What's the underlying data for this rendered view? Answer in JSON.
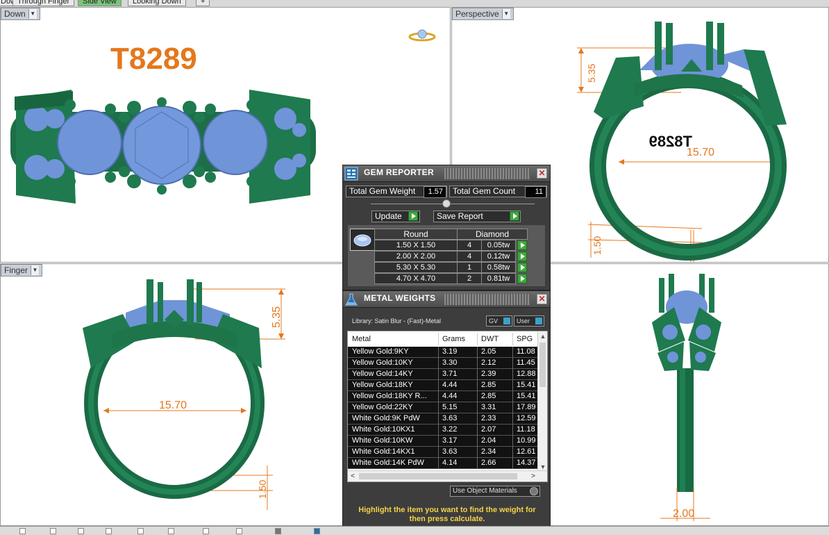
{
  "top_tabs": [
    "Down",
    "Through Finger",
    "Side View",
    "Looking Down",
    "+"
  ],
  "viewports": {
    "top_left": {
      "label": "Down",
      "model_code": "T8289"
    },
    "top_right": {
      "label": "Perspective",
      "dim_height": "5.35",
      "dim_diameter": "15.70",
      "dim_band": "1.50",
      "engraving": "T8289"
    },
    "bottom_left": {
      "label": "Finger",
      "dim_height": "5.35",
      "dim_diameter": "15.70",
      "dim_band": "1.50"
    },
    "bottom_right": {
      "dim_width": "2.00"
    }
  },
  "gem_reporter": {
    "title": "GEM REPORTER",
    "total_weight_label": "Total Gem Weight",
    "total_weight_value": "1.57",
    "total_count_label": "Total Gem Count",
    "total_count_value": "11",
    "update_label": "Update",
    "save_label": "Save Report",
    "shape": "Round",
    "material": "Diamond",
    "rows": [
      {
        "size": "1.50 X 1.50",
        "count": "4",
        "weight": "0.05tw"
      },
      {
        "size": "2.00 X 2.00",
        "count": "4",
        "weight": "0.12tw"
      },
      {
        "size": "5.30 X 5.30",
        "count": "1",
        "weight": "0.58tw"
      },
      {
        "size": "4.70 X 4.70",
        "count": "2",
        "weight": "0.81tw"
      }
    ]
  },
  "metal_weights": {
    "title": "METAL WEIGHTS",
    "library": "Library: Satin Blur - (Fast)-Metal",
    "gv_label": "GV",
    "user_label": "User",
    "columns": [
      "Metal",
      "Grams",
      "DWT",
      "SPG"
    ],
    "rows": [
      {
        "metal": "Yellow Gold:9KY",
        "grams": "3.19",
        "dwt": "2.05",
        "spg": "11.08"
      },
      {
        "metal": "Yellow Gold:10KY",
        "grams": "3.30",
        "dwt": "2.12",
        "spg": "11.45"
      },
      {
        "metal": "Yellow Gold:14KY",
        "grams": "3.71",
        "dwt": "2.39",
        "spg": "12.88"
      },
      {
        "metal": "Yellow Gold:18KY",
        "grams": "4.44",
        "dwt": "2.85",
        "spg": "15.41"
      },
      {
        "metal": "Yellow Gold:18KY R...",
        "grams": "4.44",
        "dwt": "2.85",
        "spg": "15.41"
      },
      {
        "metal": "Yellow Gold:22KY",
        "grams": "5.15",
        "dwt": "3.31",
        "spg": "17.89"
      },
      {
        "metal": "White Gold:9K PdW",
        "grams": "3.63",
        "dwt": "2.33",
        "spg": "12.59"
      },
      {
        "metal": "White Gold:10KX1",
        "grams": "3.22",
        "dwt": "2.07",
        "spg": "11.18"
      },
      {
        "metal": "White Gold:10KW",
        "grams": "3.17",
        "dwt": "2.04",
        "spg": "10.99"
      },
      {
        "metal": "White Gold:14KX1",
        "grams": "3.63",
        "dwt": "2.34",
        "spg": "12.61"
      },
      {
        "metal": "White Gold:14K PdW",
        "grams": "4.14",
        "dwt": "2.66",
        "spg": "14.37"
      }
    ],
    "use_object_materials": "Use Object Materials",
    "hint": "Highlight the item you want to find the weight for then press calculate."
  },
  "colors": {
    "metal_green": "#1f7a4f",
    "gem_blue": "#6f94d8",
    "dimension_orange": "#e4781c",
    "panel_bg": "#3d3d3d",
    "hint_yellow": "#f3d34a"
  }
}
